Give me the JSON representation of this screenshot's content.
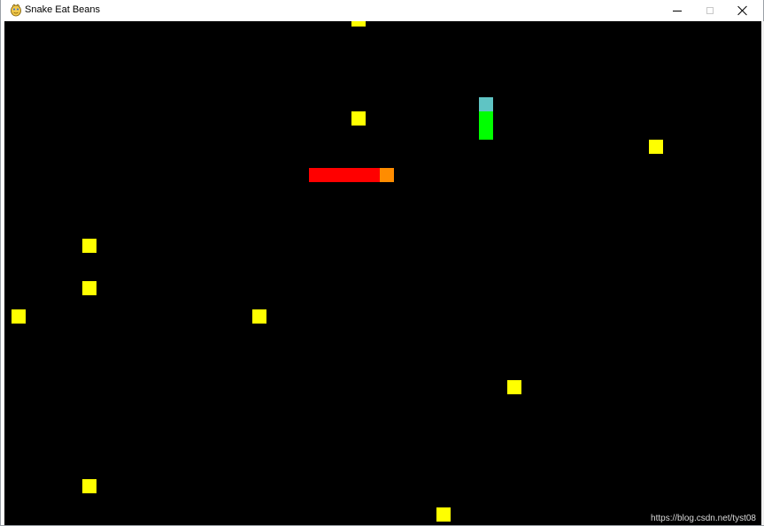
{
  "window": {
    "title": "Snake Eat Beans",
    "icon": "pygame-snake-icon",
    "controls": {
      "minimize_icon": "minimize-icon",
      "maximize_icon": "maximize-icon",
      "close_icon": "close-icon"
    }
  },
  "game": {
    "background_color": "#000000",
    "grid_cell": 16,
    "beans": {
      "color": "#ffff00",
      "cells": [
        [
          25,
          0
        ],
        [
          25,
          7
        ],
        [
          46,
          9
        ],
        [
          22,
          11
        ],
        [
          6,
          16
        ],
        [
          6,
          19
        ],
        [
          1,
          21
        ],
        [
          18,
          21
        ],
        [
          36,
          26
        ],
        [
          6,
          33
        ],
        [
          31,
          35
        ]
      ]
    },
    "snakes": [
      {
        "name": "red-snake",
        "head_color": "#ff8c00",
        "body_color": "#ff0000",
        "direction": "right",
        "head": [
          27,
          11
        ],
        "body": [
          [
            22,
            11
          ],
          [
            23,
            11
          ],
          [
            24,
            11
          ],
          [
            25,
            11
          ],
          [
            26,
            11
          ]
        ]
      },
      {
        "name": "green-snake",
        "head_color": "#5fc4c4",
        "body_color": "#00ff00",
        "direction": "up",
        "head": [
          34,
          6
        ],
        "body": [
          [
            34,
            7
          ],
          [
            34,
            8
          ]
        ]
      }
    ]
  },
  "watermark": "https://blog.csdn.net/tyst08"
}
